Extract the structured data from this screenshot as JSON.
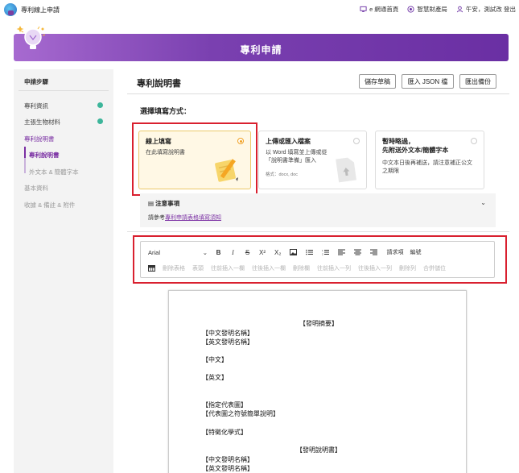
{
  "app": {
    "title": "專利線上申請"
  },
  "top_links": [
    {
      "label": "e 網通首頁",
      "icon": "monitor-icon"
    },
    {
      "label": "智慧財產局",
      "icon": "org-logo-icon"
    },
    {
      "label": "午安，測試改 登出",
      "icon": "user-icon"
    }
  ],
  "banner": {
    "title": "專利申請"
  },
  "sidebar": {
    "heading": "申請步驟",
    "items": [
      {
        "label": "專利資訊",
        "done": true
      },
      {
        "label": "主張生物材料",
        "done": true
      },
      {
        "label": "專利說明書",
        "active": true
      },
      {
        "label": "基本資料"
      },
      {
        "label": "收據 & 備註 & 附件"
      }
    ],
    "subitems": [
      {
        "label": "專利說明書",
        "active": true
      },
      {
        "label": "外文本 & 簡體字本"
      }
    ]
  },
  "main": {
    "title": "專利說明書",
    "buttons": {
      "save_draft": "儲存草稿",
      "import_json": "匯入 JSON 檔",
      "export_backup": "匯出備份"
    },
    "choose_label": "選擇填寫方式："
  },
  "options": [
    {
      "title": "線上填寫",
      "desc": "在此填寫說明書",
      "selected": true
    },
    {
      "title": "上傳或匯入檔案",
      "desc1": "以 Word 填寫並上傳或從",
      "desc2": "「說明書準備」匯入",
      "note": "格式：docx, doc"
    },
    {
      "title1": "暫時略過，",
      "title2": "先附送外文本/簡體字本",
      "desc1": "中文本日後再補送，請注意補正公文",
      "desc2": "之期限"
    }
  ],
  "notice": {
    "title": "注意事項",
    "prefix": "請參考",
    "link": "專利申請表格填寫須知"
  },
  "toolbar": {
    "font": "Arial",
    "buttons": [
      "B",
      "I",
      "S",
      "X²",
      "X₂"
    ],
    "text_buttons": [
      "請求項",
      "編號"
    ],
    "table_actions": [
      "刪除表格",
      "表頭",
      "往前插入一欄",
      "往後插入一欄",
      "刪除欄",
      "往前插入一列",
      "往後插入一列",
      "刪除列",
      "合併儲位"
    ]
  },
  "document": {
    "lines": [
      "【發明摘要】",
      "【中文發明名稱】",
      "【英文發明名稱】",
      "【中文】",
      "【英文】",
      "【指定代表圖】",
      "【代表圖之符號簡單說明】",
      "【特徵化學式】",
      "【發明說明書】",
      "【中文發明名稱】",
      "【英文發明名稱】"
    ]
  },
  "colors": {
    "brand": "#7a2fa3",
    "highlight": "#d9202f",
    "selected_card": "#fff8e5",
    "check": "#3cb59a"
  }
}
